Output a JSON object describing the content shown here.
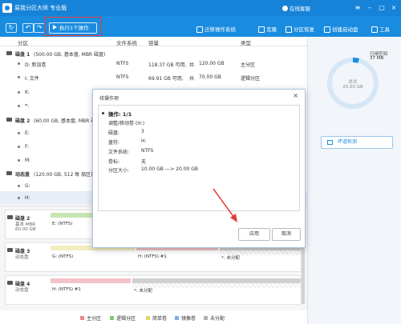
{
  "titlebar": {
    "title": "易我分区大师 专业版",
    "login": "在线客服"
  },
  "toolbar": {
    "refresh_icon": "refresh-icon",
    "undo_icon": "undo-icon",
    "redo_icon": "redo-icon",
    "execute_label": "执行1个操作",
    "items": [
      {
        "label": "迁移操作系统",
        "icon": "migrate-os-icon"
      },
      {
        "label": "克隆",
        "icon": "clone-icon"
      },
      {
        "label": "分区恢复",
        "icon": "partition-recovery-icon"
      },
      {
        "label": "创建启动盘",
        "icon": "bootable-media-icon"
      },
      {
        "label": "工具",
        "icon": "tools-icon"
      }
    ]
  },
  "list": {
    "columns": {
      "partition": "分区",
      "fs": "文件系统",
      "capacity": "容量",
      "type": "类型"
    },
    "disk1": {
      "title": "磁盘 1",
      "info": "(500.00 GB, 基本盘, MBR 磁盘)"
    },
    "disk1_parts": [
      {
        "name": "D: 新加卷",
        "fs": "NTFS",
        "used": "118.37 GB 可用,",
        "share": "共",
        "total": "120.00 GB",
        "type": "主分区"
      },
      {
        "name": "I: 文件",
        "fs": "NTFS",
        "used": "69.91 GB 可用,",
        "share": "共",
        "total": "70.00 GB",
        "type": "逻辑分区"
      },
      {
        "name": "K:"
      },
      {
        "name": "*:"
      }
    ],
    "disk2": {
      "title": "磁盘 2",
      "info": "(60.00 GB, 基本盘, MBR 磁盘)"
    },
    "disk2_parts": [
      {
        "name": "E:"
      },
      {
        "name": "F:"
      },
      {
        "name": "M:"
      }
    ],
    "disk3": {
      "title": "动态盘",
      "info": "(120.00 GB, 512 每 扇区)"
    },
    "disk3_parts": [
      {
        "name": "G:"
      },
      {
        "name": "H:"
      }
    ]
  },
  "diskmap": {
    "rows": [
      {
        "name": "磁盘 2",
        "sub": "基本 MBR",
        "size": "60.00 GB",
        "segs": [
          {
            "l1": "E: (NTFS)",
            "l2": ""
          },
          {
            "l1": "",
            "l2": ""
          }
        ]
      },
      {
        "name": "磁盘 3",
        "sub": "动态盘",
        "size": "",
        "segs": [
          {
            "l1": "G: (NTFS)",
            "l2": ""
          },
          {
            "l1": "H: (NTFS) #1",
            "l2": ""
          },
          {
            "l1": "*: 未分配",
            "l2": ""
          }
        ]
      },
      {
        "name": "磁盘 4",
        "sub": "动态盘",
        "size": "",
        "segs": [
          {
            "l1": "H: (NTFS) #1",
            "l2": ""
          },
          {
            "l1": "*: 未分配",
            "l2": ""
          }
        ]
      }
    ]
  },
  "legend": [
    {
      "label": "主分区",
      "color": "#e78a8f"
    },
    {
      "label": "逻辑分区",
      "color": "#8cc36b"
    },
    {
      "label": "简单卷",
      "color": "#e6d36a"
    },
    {
      "label": "镜像卷",
      "color": "#7fb0e3"
    },
    {
      "label": "未分配",
      "color": "#b0b0b0"
    }
  ],
  "right": {
    "used_label": "已用空间",
    "used_value": "37 MB",
    "total_label": "总共",
    "total_value": "20.00 GB",
    "badcheck": "坏道检测"
  },
  "dialog": {
    "title": "待操作项",
    "op_title": "操作: 1/1",
    "op_desc": "调整/移动卷 (H:)",
    "fields": [
      {
        "k": "磁盘:",
        "v": "3"
      },
      {
        "k": "盘符:",
        "v": "H:"
      },
      {
        "k": "文件系统:",
        "v": "NTFS"
      },
      {
        "k": "卷标:",
        "v": "无"
      },
      {
        "k": "分区大小:",
        "v": "10.00 GB ---> 20.00 GB"
      }
    ],
    "apply": "应用",
    "cancel": "取消"
  },
  "colors": {
    "accent": "#1a8ce0",
    "highlight": "#e23b3b"
  }
}
